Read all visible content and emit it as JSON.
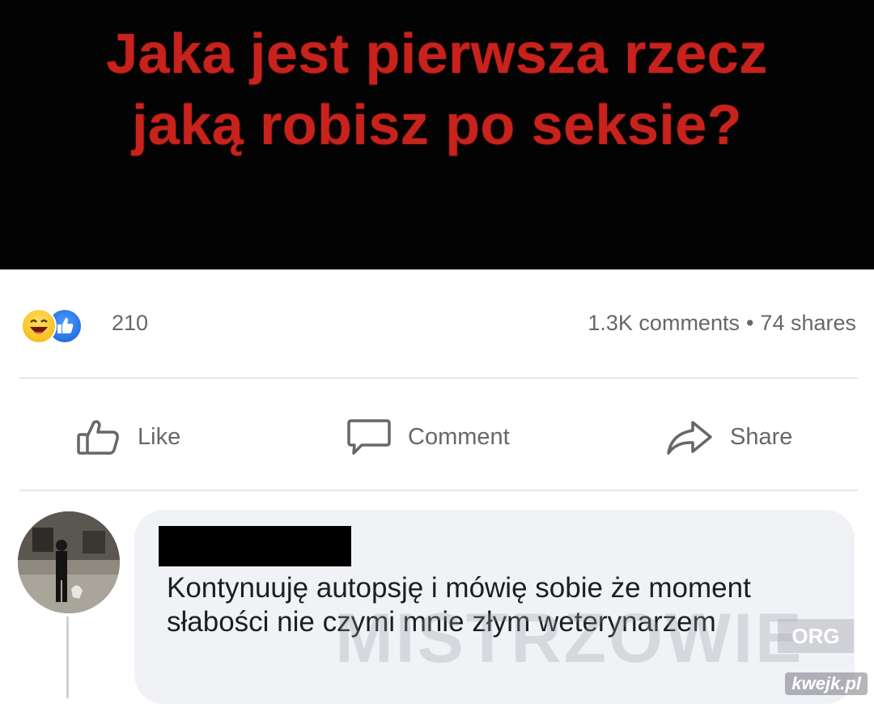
{
  "post": {
    "title_line1": "Jaka jest pierwsza rzecz",
    "title_line2": "jaką robisz po seksie?"
  },
  "stats": {
    "reaction_count": "210",
    "comments": "1.3K comments",
    "separator": "•",
    "shares": "74 shares",
    "reaction_icons": [
      "haha-reaction-icon",
      "like-reaction-icon"
    ]
  },
  "actions": {
    "like_label": "Like",
    "comment_label": "Comment",
    "share_label": "Share"
  },
  "comment": {
    "text": "Kontynuuję autopsję i mówię sobie że moment słabości nie czymi mnie złym weterynarzem"
  },
  "watermarks": {
    "mistrzowie": "MISTRZOWIE",
    "org": "ORG",
    "kwejk": "kwejk.pl"
  },
  "colors": {
    "title_red": "#c8221c",
    "muted_text": "#65676b",
    "bubble_bg": "#f0f2f5",
    "like_blue": "#1560d6"
  }
}
